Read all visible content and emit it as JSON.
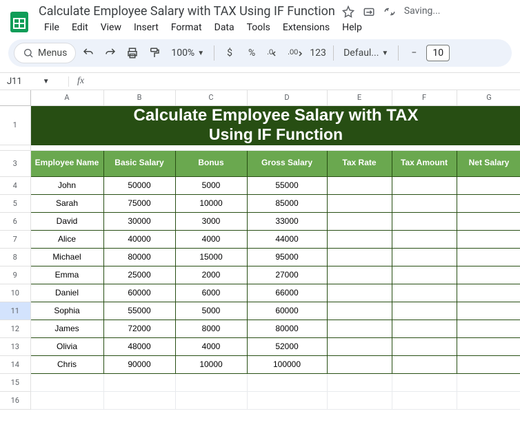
{
  "doc": {
    "title": "Calculate Employee Salary with TAX Using IF Function",
    "saving": "Saving..."
  },
  "menu": {
    "file": "File",
    "edit": "Edit",
    "view": "View",
    "insert": "Insert",
    "format": "Format",
    "data": "Data",
    "tools": "Tools",
    "extensions": "Extensions",
    "help": "Help"
  },
  "toolbar": {
    "menus": "Menus",
    "zoom": "100%",
    "currency": "$",
    "percent": "%",
    "num_plain": "123",
    "font": "Defaul...",
    "size": "10"
  },
  "namebox": {
    "cell": "J11",
    "fx": "fx",
    "formula": ""
  },
  "cols": {
    "A": "A",
    "B": "B",
    "C": "C",
    "D": "D",
    "E": "E",
    "F": "F",
    "G": "G"
  },
  "banner": {
    "line1": "Calculate Employee Salary with TAX",
    "line2": "Using IF Function"
  },
  "headers": {
    "a": "Employee Name",
    "b": "Basic Salary",
    "c": "Bonus",
    "d": "Gross Salary",
    "e": "Tax Rate",
    "f": "Tax Amount",
    "g": "Net Salary"
  },
  "rows": [
    {
      "n": "4",
      "name": "John",
      "basic": "50000",
      "bonus": "5000",
      "gross": "55000"
    },
    {
      "n": "5",
      "name": "Sarah",
      "basic": "75000",
      "bonus": "10000",
      "gross": "85000"
    },
    {
      "n": "6",
      "name": "David",
      "basic": "30000",
      "bonus": "3000",
      "gross": "33000"
    },
    {
      "n": "7",
      "name": "Alice",
      "basic": "40000",
      "bonus": "4000",
      "gross": "44000"
    },
    {
      "n": "8",
      "name": "Michael",
      "basic": "80000",
      "bonus": "15000",
      "gross": "95000"
    },
    {
      "n": "9",
      "name": "Emma",
      "basic": "25000",
      "bonus": "2000",
      "gross": "27000"
    },
    {
      "n": "10",
      "name": "Daniel",
      "basic": "60000",
      "bonus": "6000",
      "gross": "66000"
    },
    {
      "n": "11",
      "name": "Sophia",
      "basic": "55000",
      "bonus": "5000",
      "gross": "60000"
    },
    {
      "n": "12",
      "name": "James",
      "basic": "72000",
      "bonus": "8000",
      "gross": "80000"
    },
    {
      "n": "13",
      "name": "Olivia",
      "basic": "48000",
      "bonus": "4000",
      "gross": "52000"
    },
    {
      "n": "14",
      "name": "Chris",
      "basic": "90000",
      "bonus": "10000",
      "gross": "100000"
    }
  ],
  "empty_rows": [
    "15",
    "16"
  ]
}
